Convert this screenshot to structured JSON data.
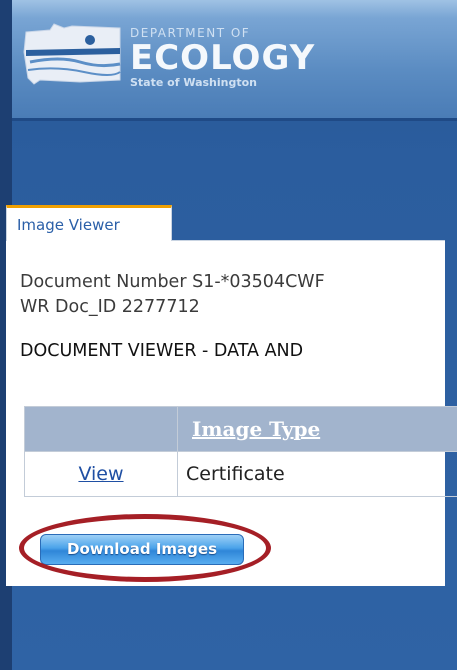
{
  "banner": {
    "department": "DEPARTMENT OF",
    "agency": "ECOLOGY",
    "state": "State of Washington"
  },
  "tab": {
    "label": "Image Viewer"
  },
  "document": {
    "number_line": "Document Number S1-*03504CWF",
    "doc_id_line": "WR Doc_ID 2277712",
    "viewer_title": "DOCUMENT VIEWER - DATA AND"
  },
  "table": {
    "header": "Image Type",
    "rows": [
      {
        "action": "View",
        "type": "Certificate"
      }
    ]
  },
  "download_button": {
    "label": "Download Images"
  },
  "colors": {
    "annotation_circle": "#a51f26",
    "tab_accent": "#f0a000",
    "link": "#1f4fa3",
    "header_bg": "#a2b4cd"
  }
}
